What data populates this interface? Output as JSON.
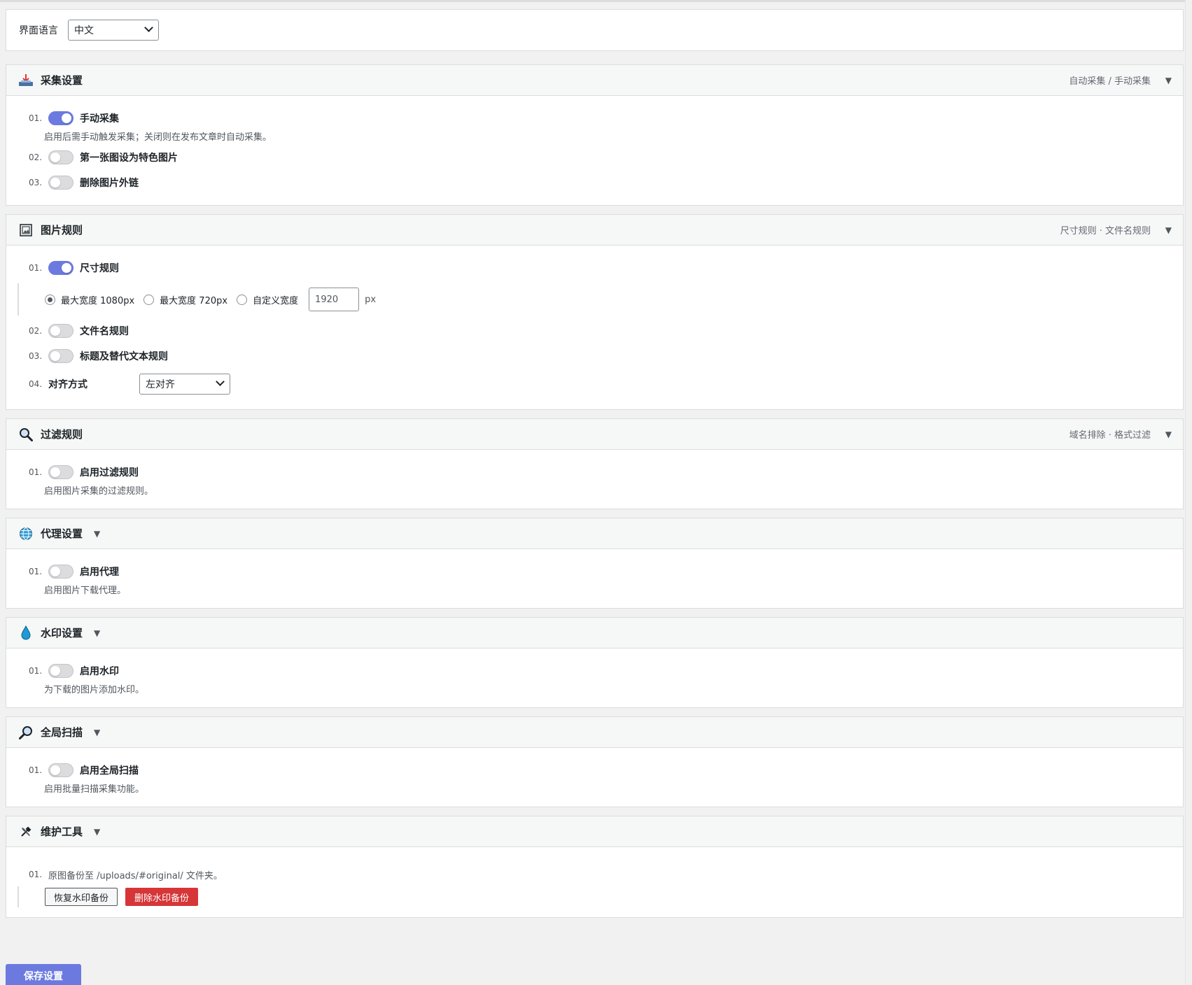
{
  "language": {
    "label": "界面语言",
    "value": "中文"
  },
  "sections": {
    "collect": {
      "title": "采集设置",
      "sub": "自动采集 / 手动采集",
      "items": [
        {
          "num": "01.",
          "label": "手动采集",
          "on": true,
          "desc": "启用后需手动触发采集；关闭则在发布文章时自动采集。"
        },
        {
          "num": "02.",
          "label": "第一张图设为特色图片",
          "on": false
        },
        {
          "num": "03.",
          "label": "删除图片外链",
          "on": false
        }
      ]
    },
    "image_rules": {
      "title": "图片规则",
      "sub": "尺寸规则 · 文件名规则",
      "items": [
        {
          "num": "01.",
          "label": "尺寸规则",
          "on": true
        },
        {
          "num": "02.",
          "label": "文件名规则",
          "on": false
        },
        {
          "num": "03.",
          "label": "标题及替代文本规则",
          "on": false
        },
        {
          "num": "04.",
          "label": "对齐方式",
          "value": "左对齐"
        }
      ],
      "size_options": [
        "最大宽度 1080px",
        "最大宽度 720px",
        "自定义宽度"
      ],
      "custom_width": "1920",
      "unit": "px"
    },
    "filter": {
      "title": "过滤规则",
      "sub": "域名排除 · 格式过滤",
      "items": [
        {
          "num": "01.",
          "label": "启用过滤规则",
          "on": false,
          "desc": "启用图片采集的过滤规则。"
        }
      ]
    },
    "proxy": {
      "title": "代理设置",
      "items": [
        {
          "num": "01.",
          "label": "启用代理",
          "on": false,
          "desc": "启用图片下载代理。"
        }
      ]
    },
    "watermark": {
      "title": "水印设置",
      "items": [
        {
          "num": "01.",
          "label": "启用水印",
          "on": false,
          "desc": "为下载的图片添加水印。"
        }
      ]
    },
    "scan": {
      "title": "全局扫描",
      "items": [
        {
          "num": "01.",
          "label": "启用全局扫描",
          "on": false,
          "desc": "启用批量扫描采集功能。"
        }
      ]
    },
    "maintenance": {
      "title": "维护工具",
      "num": "01.",
      "text": "原图备份至 /uploads/#original/ 文件夹。",
      "restore_label": "恢复水印备份",
      "delete_label": "删除水印备份"
    }
  },
  "save_label": "保存设置",
  "colors": {
    "accent": "#6c7ae0",
    "danger": "#d63638"
  },
  "icons": {
    "collect": "download-tray-icon",
    "image_rules": "framed-picture-icon",
    "filter": "magnifier-icon",
    "proxy": "globe-icon",
    "watermark": "droplet-icon",
    "scan": "magnifier-right-icon",
    "maintenance": "hammer-wrench-icon"
  }
}
